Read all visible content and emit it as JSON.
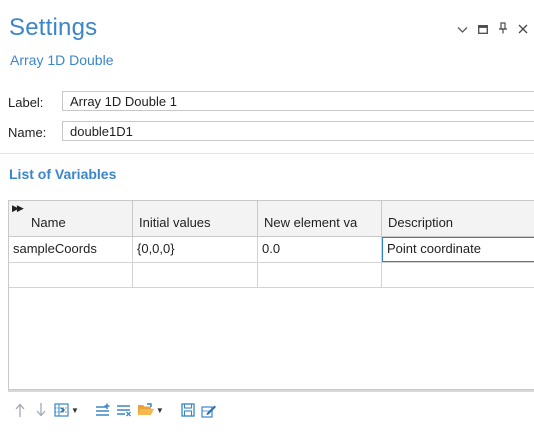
{
  "header": {
    "title": "Settings",
    "subtitle": "Array 1D Double",
    "controls": [
      {
        "icon": "chevron-down-icon",
        "glyph": "⌄"
      },
      {
        "icon": "maximize-icon",
        "glyph": "▭"
      },
      {
        "icon": "pin-icon",
        "glyph": "⊥"
      },
      {
        "icon": "close-icon",
        "glyph": "✕"
      }
    ]
  },
  "fields": {
    "label": {
      "label": "Label:",
      "value": "Array 1D Double 1"
    },
    "name": {
      "label": "Name:",
      "value": "double1D1"
    }
  },
  "variables": {
    "section_title": "List of Variables",
    "columns": [
      "Name",
      "Initial values",
      "New element va",
      "Description"
    ],
    "rows": [
      {
        "name": "sampleCoords",
        "initial": "{0,0,0}",
        "new_element": "0.0",
        "description": "Point coordinate"
      },
      {
        "name": "",
        "initial": "",
        "new_element": "",
        "description": ""
      }
    ]
  },
  "toolbar": {
    "buttons": [
      "move-up-icon",
      "move-down-icon",
      "insert-column-icon",
      "add-row-icon",
      "delete-row-icon",
      "open-folder-icon",
      "save-icon",
      "edit-icon"
    ]
  },
  "colors": {
    "accent": "#3a86c8",
    "active_cell_border": "#2f80c9"
  }
}
